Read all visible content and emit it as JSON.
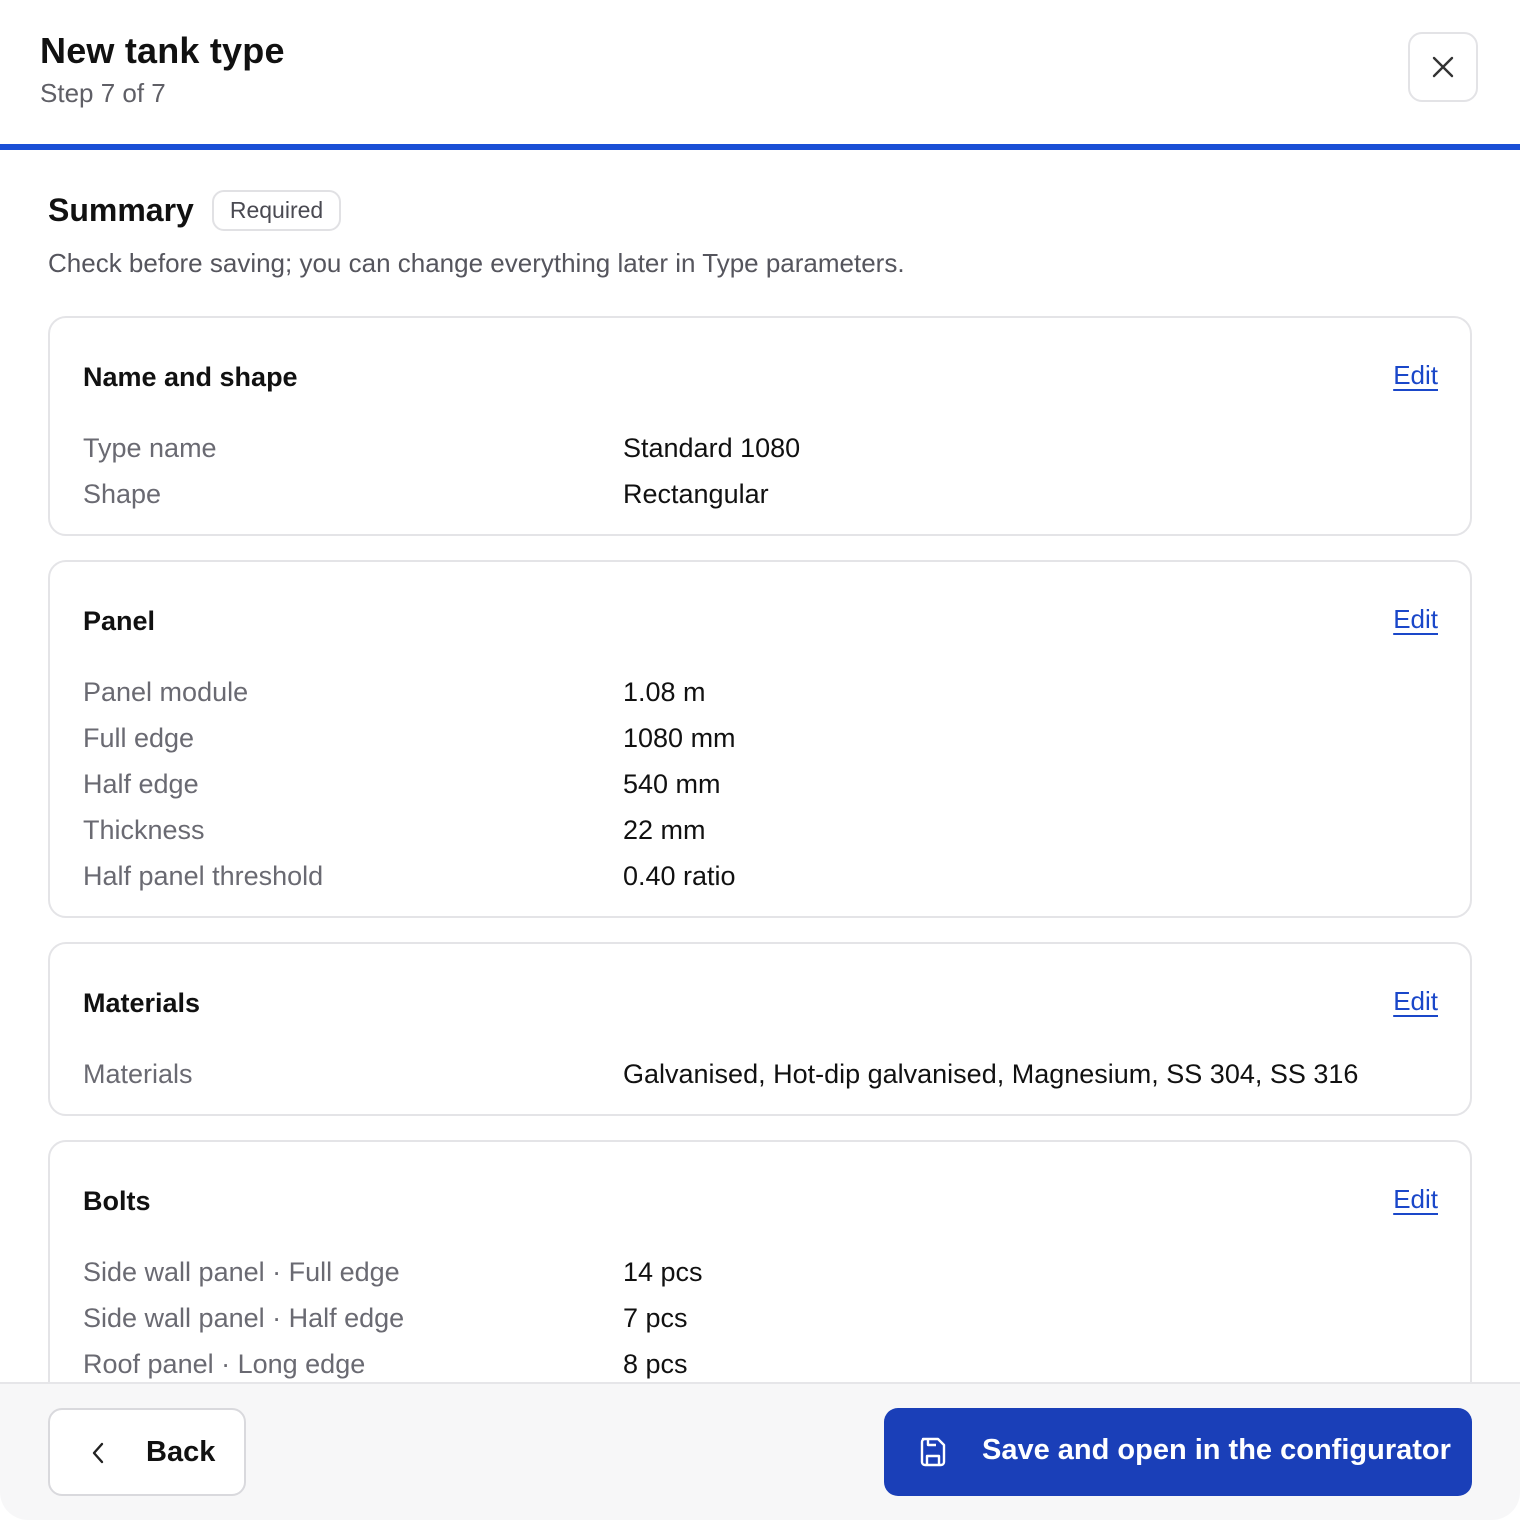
{
  "header": {
    "title": "New tank type",
    "step": "Step 7 of 7",
    "progress": 1.0
  },
  "summary": {
    "title": "Summary",
    "badge": "Required",
    "description": "Check before saving; you can change everything later in Type parameters."
  },
  "cards": {
    "name_shape": {
      "title": "Name and shape",
      "edit": "Edit",
      "rows": [
        {
          "label": "Type name",
          "value": "Standard 1080"
        },
        {
          "label": "Shape",
          "value": "Rectangular"
        }
      ]
    },
    "panel": {
      "title": "Panel",
      "edit": "Edit",
      "rows": [
        {
          "label": "Panel module",
          "value": "1.08 m"
        },
        {
          "label": "Full edge",
          "value": "1080 mm"
        },
        {
          "label": "Half edge",
          "value": "540 mm"
        },
        {
          "label": "Thickness",
          "value": "22 mm"
        },
        {
          "label": "Half panel threshold",
          "value": "0.40 ratio"
        }
      ]
    },
    "materials": {
      "title": "Materials",
      "edit": "Edit",
      "rows": [
        {
          "label": "Materials",
          "value": "Galvanised, Hot-dip galvanised, Magnesium, SS 304, SS 316"
        }
      ]
    },
    "bolts": {
      "title": "Bolts",
      "edit": "Edit",
      "rows": [
        {
          "label": "Side wall panel · Full edge",
          "value": "14 pcs"
        },
        {
          "label": "Side wall panel · Half edge",
          "value": "7 pcs"
        },
        {
          "label": "Roof panel · Long edge",
          "value": "8 pcs"
        }
      ]
    }
  },
  "footer": {
    "back": "Back",
    "save": "Save and open in the configurator"
  },
  "icons": {
    "close": "close-icon",
    "back": "chevron-left-icon",
    "save": "save-icon"
  },
  "colors": {
    "accent": "#1a4fd6",
    "primary_button": "#1a3fb8",
    "link": "#1a47c9"
  }
}
